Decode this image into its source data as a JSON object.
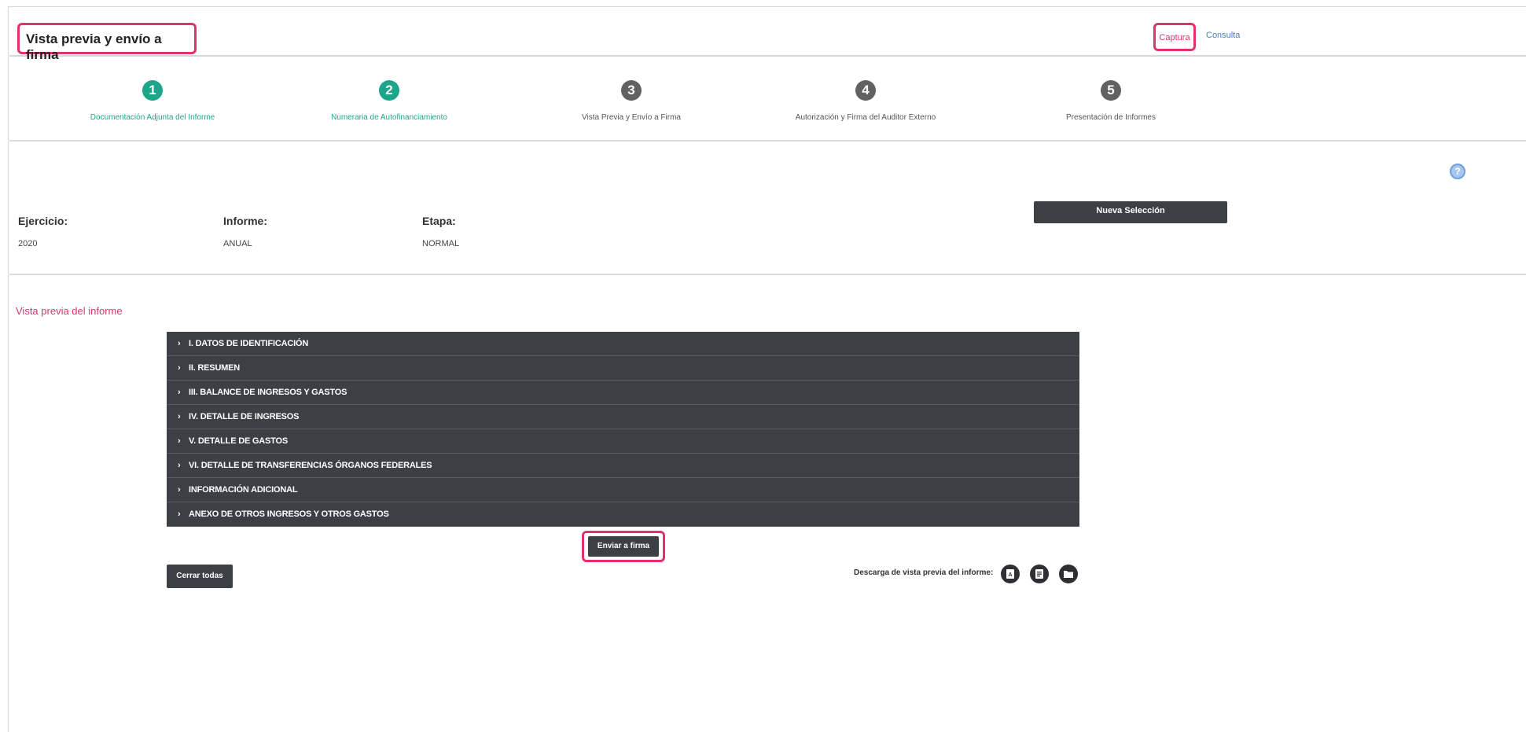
{
  "header": {
    "title": "Vista previa y envío a firma",
    "nav": {
      "captura": "Captura",
      "consulta": "Consulta"
    }
  },
  "stepper": {
    "steps": [
      {
        "number": "1",
        "label": "Documentación Adjunta del Informe",
        "status": "done"
      },
      {
        "number": "2",
        "label": "Numeraria de Autofinanciamiento",
        "status": "done"
      },
      {
        "number": "3",
        "label": "Vista Previa y Envío a Firma",
        "status": "pending"
      },
      {
        "number": "4",
        "label": "Autorización y Firma del Auditor Externo",
        "status": "pending"
      },
      {
        "number": "5",
        "label": "Presentación de Informes",
        "status": "pending"
      }
    ]
  },
  "info": {
    "help_icon": "?",
    "nueva_seleccion": "Nueva Selección",
    "fields": [
      {
        "label": "Ejercicio:",
        "value": "2020"
      },
      {
        "label": "Informe:",
        "value": "ANUAL"
      },
      {
        "label": "Etapa:",
        "value": "NORMAL"
      }
    ]
  },
  "preview": {
    "title": "Vista previa del informe",
    "sections": [
      "I. DATOS DE IDENTIFICACIÓN",
      "II. RESUMEN",
      "III. BALANCE DE INGRESOS Y GASTOS",
      "IV. DETALLE DE INGRESOS",
      "V. DETALLE DE GASTOS",
      "VI. DETALLE DE TRANSFERENCIAS ÓRGANOS FEDERALES",
      "INFORMACIÓN ADICIONAL",
      "ANEXO DE OTROS INGRESOS Y OTROS GASTOS"
    ],
    "enviar": "Enviar a firma",
    "cerrar": "Cerrar todas",
    "descarga_label": "Descarga de vista previa del informe:",
    "download_icons": [
      "pdf-icon",
      "document-icon",
      "folder-icon"
    ]
  },
  "colors": {
    "accent": "#e0336e",
    "step_done": "#1da58a",
    "step_pending": "#616161",
    "dark_bar": "#3c3f43",
    "link": "#4a7fc0"
  }
}
